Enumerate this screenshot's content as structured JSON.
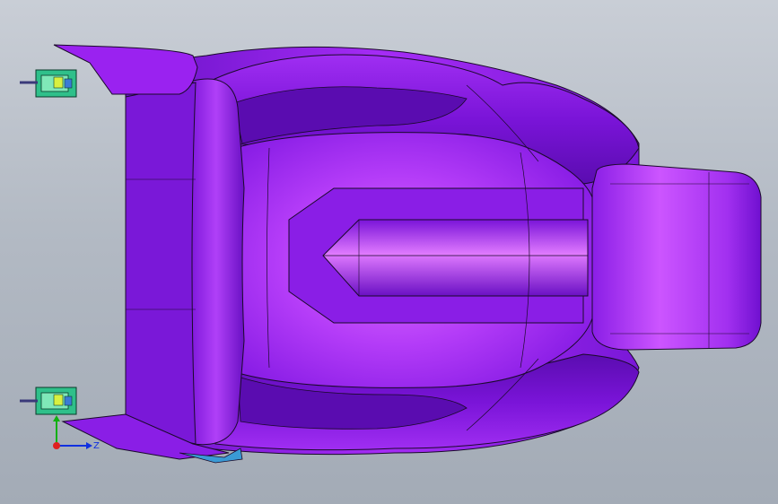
{
  "app": {
    "view_name": "cad-3d-viewport"
  },
  "model": {
    "part": "car-seat-assembly",
    "body_color": "#9a22f0",
    "highlight_color": "#d45cff",
    "shadow_color": "#5e0fb4",
    "edge_color": "#1a0a2a",
    "bracket_color": "#2fc08a",
    "bracket_accent_color": "#3a7bd5"
  },
  "triad": {
    "z_label": "Z",
    "x_axis_color": "#1030e0",
    "y_axis_color": "#10b010",
    "origin_color": "#e02020"
  },
  "icons": {
    "triad": "coordinate-triad-icon",
    "bracket_top": "mounting-bracket-icon",
    "bracket_bottom": "mounting-bracket-icon"
  }
}
